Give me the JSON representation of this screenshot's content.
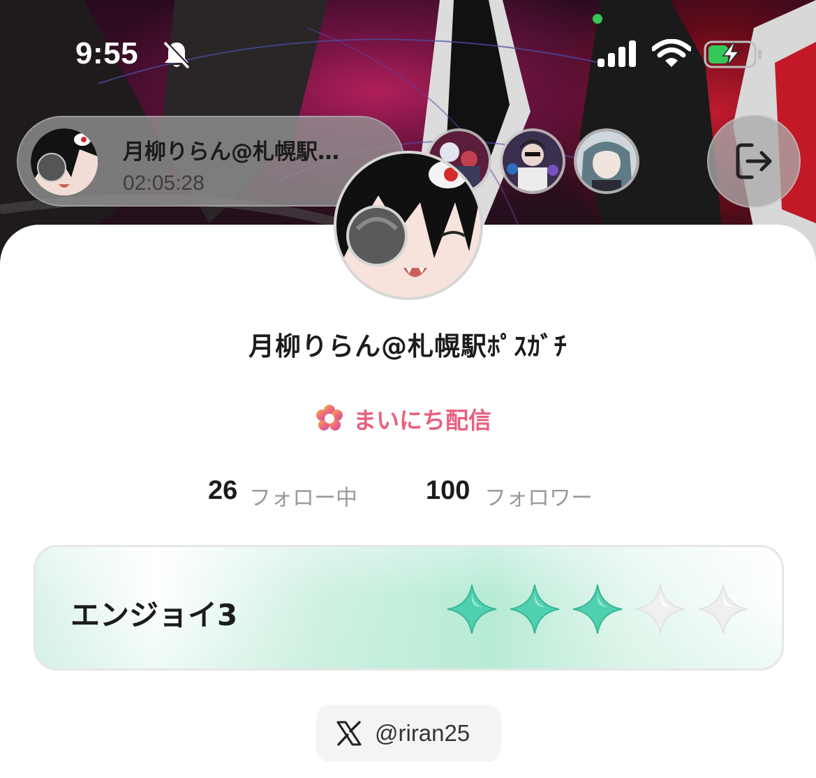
{
  "status_bar": {
    "time": "9:55",
    "silent_icon": "bell-slash-icon",
    "signal_icon": "cellular-signal-icon",
    "wifi_icon": "wifi-icon",
    "battery_icon": "battery-charging-icon",
    "battery_level": 0.45,
    "battery_color": "#34c759"
  },
  "stream": {
    "streamer_name": "月柳りらん@札幌駅…",
    "elapsed_time": "02:05:28",
    "viewer_count_shown": 3,
    "exit_icon": "exit-door-arrow-icon"
  },
  "profile": {
    "display_name": "月柳りらん@札幌駅ﾎﾟｽｶﾞﾁ",
    "daily_badge": {
      "icon": "flower-badge-icon",
      "label": "まいにち配信",
      "color": "#e8607f"
    },
    "following": {
      "count": "26",
      "label": "フォロー中"
    },
    "followers": {
      "count": "100",
      "label": "フォロワー"
    }
  },
  "rank": {
    "label": "エンジョイ3",
    "stars_total": 5,
    "stars_filled": 3,
    "filled_color": "#4fd1b0",
    "empty_color": "#f0f0f0"
  },
  "social": {
    "x_icon": "x-logo-icon",
    "handle": "@riran25"
  }
}
